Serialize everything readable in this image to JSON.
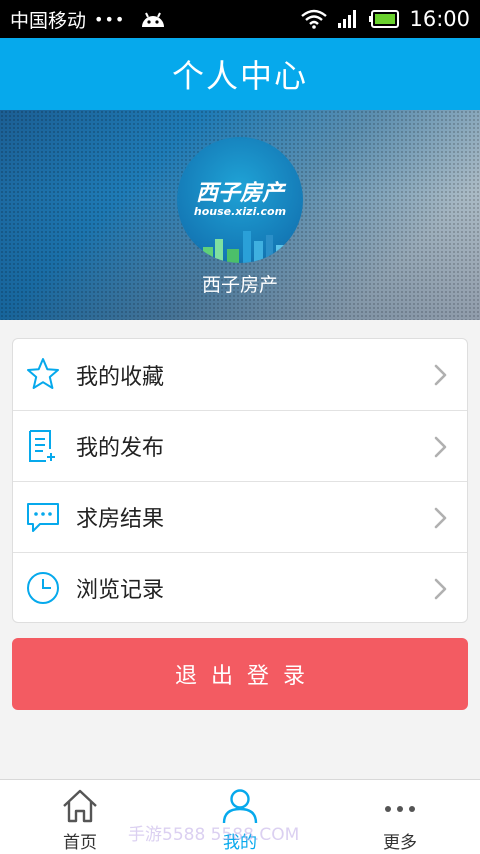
{
  "status_bar": {
    "carrier": "中国移动",
    "dots": "•••",
    "time": "16:00"
  },
  "header": {
    "title": "个人中心"
  },
  "profile": {
    "avatar_logo_text": "西子房产",
    "avatar_logo_url": "house.xizi.com",
    "username": "西子房产"
  },
  "menu": {
    "items": [
      {
        "label": "我的收藏",
        "icon": "star-icon"
      },
      {
        "label": "我的发布",
        "icon": "document-icon"
      },
      {
        "label": "求房结果",
        "icon": "chat-bubble-icon"
      },
      {
        "label": "浏览记录",
        "icon": "clock-icon"
      }
    ]
  },
  "logout": {
    "label": "退出登录"
  },
  "tabbar": {
    "tabs": [
      {
        "label": "首页",
        "icon": "home-icon",
        "active": false
      },
      {
        "label": "我的",
        "icon": "person-icon",
        "active": true
      },
      {
        "label": "更多",
        "icon": "more-dots-icon",
        "active": false
      }
    ]
  },
  "watermark": "手游5588 5588.COM",
  "colors": {
    "header": "#06a9ec",
    "accent": "#06a9ec",
    "logout": "#f35b62",
    "battery": "#6ad12e"
  }
}
